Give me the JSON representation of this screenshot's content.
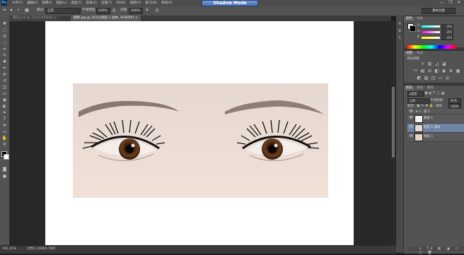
{
  "app": {
    "logo": "Ps"
  },
  "menu": [
    "文件(F)",
    "编辑(E)",
    "图像(I)",
    "图层(L)",
    "类型(Y)",
    "选择(S)",
    "滤镜(T)",
    "3D(D)",
    "视图(V)",
    "窗口(W)",
    "帮助(H)"
  ],
  "shadow_mode": "Shadow Mode",
  "window_controls": {
    "minimize": "—",
    "restore": "❐",
    "close": "✕"
  },
  "options": {
    "mode_label": "模式:",
    "mode_value": "正常",
    "opacity_label": "不透明度:",
    "opacity_value": "100%",
    "flow_label": "流量:",
    "flow_value": "100%",
    "workspace": "基本功能"
  },
  "tabs": [
    {
      "label": "眼毛.psd @ 123.5(RGB/8) ×"
    },
    {
      "label": "眼睛.jpg @ 161%(图层 1 副本, RGB/8#) ×"
    }
  ],
  "tools": [
    "move",
    "marquee",
    "lasso",
    "quick-select",
    "crop",
    "eyedropper",
    "heal",
    "brush",
    "clone",
    "history",
    "eraser",
    "gradient",
    "blur",
    "dodge",
    "pen",
    "type",
    "path-select",
    "shape",
    "hand",
    "zoom"
  ],
  "tool_glyphs": [
    "✥",
    "⬚",
    "ʘ",
    "◌",
    "⌗",
    "✎",
    "✚",
    "✏",
    "⎆",
    "↺",
    "◫",
    "▭",
    "◉",
    "◐",
    "✒",
    "T",
    "➤",
    "▭",
    "✋",
    "⚲"
  ],
  "status": {
    "zoom": "161.25%",
    "doc": "文档:1.46M/4.70M"
  },
  "panels": {
    "color": {
      "tabs": [
        "颜色",
        "色板"
      ],
      "r": "255",
      "g": "255",
      "b": "255"
    },
    "adjustments": {
      "tabs": [
        "调整",
        "样式"
      ],
      "label": "添加调整"
    },
    "layers": {
      "tabs": [
        "图层",
        "通道",
        "路径"
      ],
      "kind": "ρ类型",
      "blend": "正常",
      "opacity_label": "不透明度:",
      "opacity": "91%",
      "lock_label": "锁定:",
      "fill_label": "填充:",
      "fill": "100%",
      "items": [
        {
          "name": "组 1"
        },
        {
          "name": "图层 1"
        },
        {
          "name": "图层 1 副本"
        },
        {
          "name": "图层 1"
        }
      ]
    }
  },
  "colors": {
    "fg": "#000000",
    "bg": "#ffffff",
    "selected_layer": "#6f83a4"
  }
}
